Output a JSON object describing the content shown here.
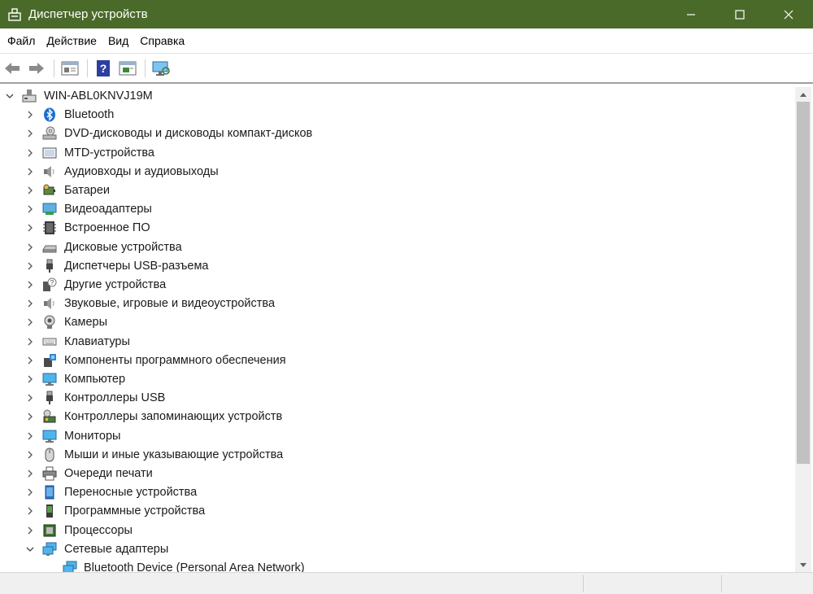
{
  "window": {
    "title": "Диспетчер устройств",
    "title_bar_color": "#4a6a2a",
    "icon": "device-manager-icon",
    "controls": [
      "minimize-icon",
      "maximize-icon",
      "close-icon"
    ]
  },
  "menu": {
    "items": [
      "Файл",
      "Действие",
      "Вид",
      "Справка"
    ]
  },
  "toolbar": {
    "buttons": [
      "back-arrow-icon",
      "forward-arrow-icon",
      "properties-icon",
      "help-icon",
      "update-driver-icon",
      "scan-hardware-icon"
    ]
  },
  "tree": {
    "root": {
      "label": "WIN-ABL0KNVJ19M",
      "expanded": true,
      "icon": "computer-icon"
    },
    "categories": [
      {
        "label": "Bluetooth",
        "icon": "bluetooth-icon",
        "expanded": false
      },
      {
        "label": "DVD-дисководы и дисководы компакт-дисков",
        "icon": "dvd-drive-icon",
        "expanded": false
      },
      {
        "label": "MTD-устройства",
        "icon": "mtd-device-icon",
        "expanded": false
      },
      {
        "label": "Аудиовходы и аудиовыходы",
        "icon": "speaker-icon",
        "expanded": false
      },
      {
        "label": "Батареи",
        "icon": "battery-icon",
        "expanded": false
      },
      {
        "label": "Видеоадаптеры",
        "icon": "display-adapter-icon",
        "expanded": false
      },
      {
        "label": "Встроенное ПО",
        "icon": "firmware-icon",
        "expanded": false
      },
      {
        "label": "Дисковые устройства",
        "icon": "disk-drive-icon",
        "expanded": false
      },
      {
        "label": "Диспетчеры USB-разъема",
        "icon": "usb-connector-icon",
        "expanded": false
      },
      {
        "label": "Другие устройства",
        "icon": "unknown-device-icon",
        "expanded": false
      },
      {
        "label": "Звуковые, игровые и видеоустройства",
        "icon": "sound-device-icon",
        "expanded": false
      },
      {
        "label": "Камеры",
        "icon": "camera-icon",
        "expanded": false
      },
      {
        "label": "Клавиатуры",
        "icon": "keyboard-icon",
        "expanded": false
      },
      {
        "label": "Компоненты программного обеспечения",
        "icon": "software-component-icon",
        "expanded": false
      },
      {
        "label": "Компьютер",
        "icon": "monitor-icon",
        "expanded": false
      },
      {
        "label": "Контроллеры USB",
        "icon": "usb-icon",
        "expanded": false
      },
      {
        "label": "Контроллеры запоминающих устройств",
        "icon": "storage-controller-icon",
        "expanded": false
      },
      {
        "label": "Мониторы",
        "icon": "monitor-icon",
        "expanded": false
      },
      {
        "label": "Мыши и иные указывающие устройства",
        "icon": "mouse-icon",
        "expanded": false
      },
      {
        "label": "Очереди печати",
        "icon": "printer-icon",
        "expanded": false
      },
      {
        "label": "Переносные устройства",
        "icon": "portable-device-icon",
        "expanded": false
      },
      {
        "label": "Программные устройства",
        "icon": "software-device-icon",
        "expanded": false
      },
      {
        "label": "Процессоры",
        "icon": "processor-icon",
        "expanded": false
      },
      {
        "label": "Сетевые адаптеры",
        "icon": "network-adapter-icon",
        "expanded": true
      }
    ],
    "children": [
      {
        "label": "Bluetooth Device (Personal Area Network)",
        "icon": "network-adapter-icon"
      }
    ]
  }
}
